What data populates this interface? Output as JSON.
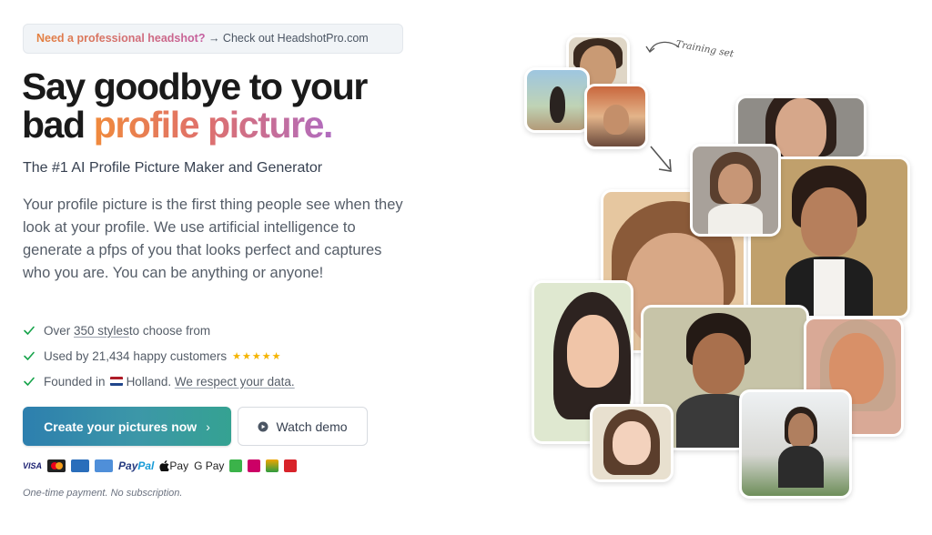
{
  "banner": {
    "highlight": "Need a professional headshot?",
    "rest": " → Check out HeadshotPro.com"
  },
  "headline": {
    "line1": "Say goodbye to your",
    "line2_prefix": "bad ",
    "line2_accent": "profile picture."
  },
  "subtitle": "The #1 AI Profile Picture Maker and Generator",
  "description": "Your profile picture is the first thing people see when they look at your profile. We use artificial intelligence to generate a pfps of you that looks perfect and captures who you are. You can be anything or anyone!",
  "features": [
    {
      "pre": "Over ",
      "link": "350 styles",
      "post": " to choose from"
    },
    {
      "text": "Used by 21,434 happy customers",
      "stars": "★★★★★"
    },
    {
      "pre": "Founded in ",
      "country": "Holland.",
      "link": "We respect your data."
    }
  ],
  "cta": {
    "primary_label": "Create your pictures now",
    "primary_chevron": "›",
    "secondary_label": "Watch demo"
  },
  "payments": {
    "visa": "VISA",
    "paypal_a": "Pay",
    "paypal_b": "Pal",
    "apple_pay": "Pay",
    "google_pay": "G Pay",
    "logos": [
      "visa",
      "mastercard",
      "maestro",
      "amex",
      "paypal",
      "apple-pay",
      "google-pay",
      "generic",
      "ideal",
      "sofort",
      "giropay"
    ]
  },
  "footnote": "One-time payment. No subscription.",
  "collage": {
    "annotation": "Training set"
  },
  "colors": {
    "accent_orange": "#f08a3c",
    "accent_purple": "#b06cc0",
    "cta_start": "#2d7fae",
    "cta_end": "#35a292",
    "check_green": "#16a34a",
    "star_yellow": "#f5b400"
  }
}
